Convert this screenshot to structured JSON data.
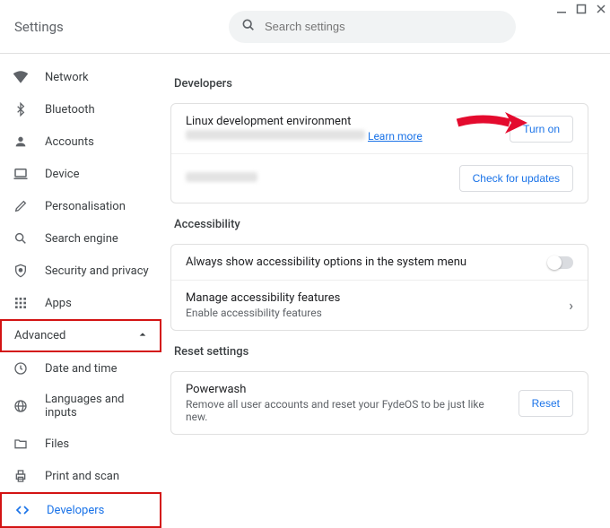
{
  "window": {
    "title": "Settings"
  },
  "search": {
    "placeholder": "Search settings"
  },
  "sidebar": {
    "items": [
      {
        "label": "Network"
      },
      {
        "label": "Bluetooth"
      },
      {
        "label": "Accounts"
      },
      {
        "label": "Device"
      },
      {
        "label": "Personalisation"
      },
      {
        "label": "Search engine"
      },
      {
        "label": "Security and privacy"
      },
      {
        "label": "Apps"
      }
    ],
    "advanced_label": "Advanced",
    "advanced": [
      {
        "label": "Date and time"
      },
      {
        "label": "Languages and inputs"
      },
      {
        "label": "Files"
      },
      {
        "label": "Print and scan"
      },
      {
        "label": "Developers"
      }
    ]
  },
  "content": {
    "developers": {
      "heading": "Developers",
      "linux_title": "Linux development environment",
      "linux_learn": "Learn more",
      "turn_on": "Turn on",
      "check_updates": "Check for updates"
    },
    "accessibility": {
      "heading": "Accessibility",
      "always_show": "Always show accessibility options in the system menu",
      "manage_title": "Manage accessibility features",
      "manage_sub": "Enable accessibility features"
    },
    "reset": {
      "heading": "Reset settings",
      "power_title": "Powerwash",
      "power_sub": "Remove all user accounts and reset your FydeOS to be just like new.",
      "reset_btn": "Reset"
    }
  }
}
